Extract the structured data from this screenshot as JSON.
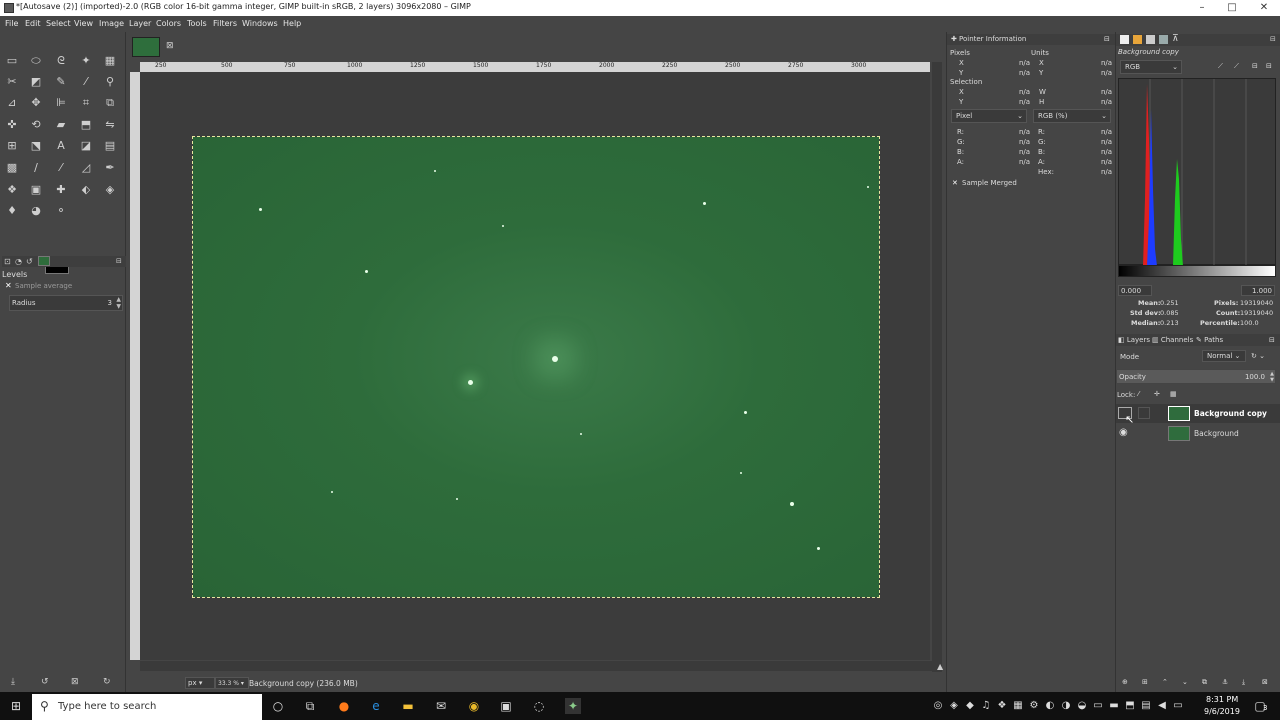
{
  "window": {
    "title": "*[Autosave (2)] (imported)-2.0 (RGB color 16-bit gamma integer, GIMP built-in sRGB, 2 layers) 3096x2080 – GIMP",
    "minimize": "–",
    "maximize": "□",
    "close": "✕"
  },
  "menu": [
    "File",
    "Edit",
    "Select",
    "View",
    "Image",
    "Layer",
    "Colors",
    "Tools",
    "Filters",
    "Windows",
    "Help"
  ],
  "toolbox": {
    "panel_title": "Levels",
    "sample_average": "Sample average",
    "radius_label": "Radius",
    "radius_value": "3"
  },
  "canvas": {
    "zoom_unit": "px",
    "zoom_value": "33.3 %",
    "status": "Background copy (236.0 MB)",
    "ruler_ticks": [
      "250",
      "500",
      "750",
      "1000",
      "1250",
      "1500",
      "1750",
      "2000",
      "2250",
      "2500",
      "2750",
      "3000"
    ]
  },
  "pointer": {
    "title": "Pointer Information",
    "pixels": "Pixels",
    "units": "Units",
    "x": "X",
    "y": "Y",
    "na": "n/a",
    "selection": "Selection",
    "w": "W",
    "h": "H",
    "pixel_mode": "Pixel",
    "rgb_mode": "RGB (%)",
    "r": "R:",
    "g": "G:",
    "b": "B:",
    "a": "A:",
    "hex": "Hex:",
    "sample_merged": "Sample Merged"
  },
  "histogram": {
    "layer": "Background copy",
    "channel": "RGB",
    "range_low": "0.000",
    "range_high": "1.000",
    "mean_label": "Mean:",
    "mean": "0.251",
    "stddev_label": "Std dev:",
    "stddev": "0.085",
    "median_label": "Median:",
    "median": "0.213",
    "pixels_label": "Pixels:",
    "pixels": "19319040",
    "count_label": "Count:",
    "count": "19319040",
    "percentile_label": "Percentile:",
    "percentile": "100.0"
  },
  "layers": {
    "tabs": [
      "Layers",
      "Channels",
      "Paths"
    ],
    "mode_label": "Mode",
    "mode_value": "Normal",
    "opacity_label": "Opacity",
    "opacity_value": "100.0",
    "lock_label": "Lock:",
    "items": [
      {
        "name": "Background copy",
        "visible": false
      },
      {
        "name": "Background",
        "visible": true
      }
    ]
  },
  "taskbar": {
    "search_placeholder": "Type here to search",
    "time": "8:31 PM",
    "date": "9/6/2019",
    "notifications": "3"
  },
  "colors": {
    "image_green": "#2e6c3b",
    "selection_dash": "#e8e8a0"
  }
}
